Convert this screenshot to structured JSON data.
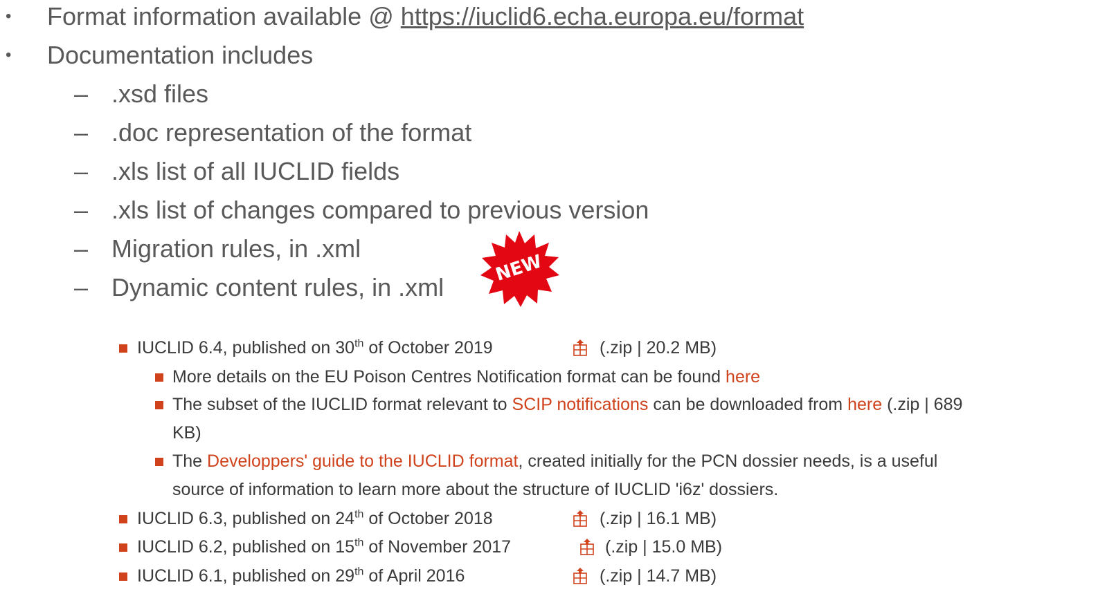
{
  "slide": {
    "bullets": [
      {
        "prefix": "Format information available @ ",
        "link": "https://iuclid6.echa.europa.eu/format"
      },
      {
        "text": "Documentation includes"
      }
    ],
    "sub_bullets": [
      ".xsd files",
      ".doc representation of the format",
      ".xls list of all IUCLID fields",
      ".xls list of changes compared to previous version",
      "Migration rules, in .xml",
      "Dynamic content rules, in .xml"
    ],
    "bullet_glyph": "•",
    "dash_glyph": "–",
    "badge": {
      "text": "NEW",
      "color": "#e30613"
    }
  },
  "releases": {
    "iuclid64": {
      "name": "IUCLID 6.4, published on 30",
      "sup": "th",
      "rest": " of October 2019",
      "file": "(.zip | 20.2 MB)",
      "details": {
        "pcn": {
          "text": "More details on the EU Poison Centres Notification format can be found ",
          "link": "here"
        },
        "scip": {
          "t1": "The subset of the IUCLID format relevant to ",
          "link1": "SCIP notifications",
          "t2": " can be downloaded from ",
          "link2": "here",
          "t3": " (.zip | 689",
          "t4": "KB)"
        },
        "guide": {
          "t1": "The ",
          "link": "Developpers' guide to the IUCLID format",
          "t2": ", created initially for the PCN dossier needs, is a useful",
          "t3": "source of information to learn more about the structure of IUCLID 'i6z' dossiers."
        }
      }
    },
    "iuclid63": {
      "name": "IUCLID 6.3, published on 24",
      "sup": "th",
      "rest": " of October 2018",
      "file": "(.zip | 16.1 MB)"
    },
    "iuclid62": {
      "name": "IUCLID 6.2, published on 15",
      "sup": "th",
      "rest": " of November 2017",
      "file": "(.zip | 15.0 MB)"
    },
    "iuclid61": {
      "name": "IUCLID 6.1, published on 29",
      "sup": "th",
      "rest": " of April 2016",
      "file": "(.zip | 14.7 MB)"
    }
  },
  "colors": {
    "accent": "#d0421b",
    "slide_text": "#595959",
    "web_text": "#3a3a3a"
  },
  "icons": [
    "bullet-dot",
    "dash",
    "new-starburst-badge",
    "red-square-bullet",
    "download-package-icon"
  ]
}
